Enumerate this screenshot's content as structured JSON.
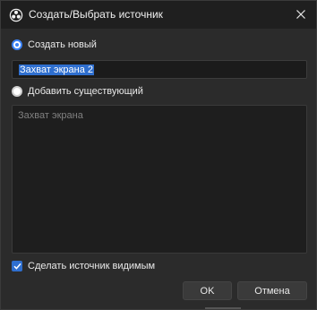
{
  "window": {
    "title": "Создать/Выбрать источник",
    "icon": "obs-logo-icon"
  },
  "options": {
    "create_new_label": "Создать новый",
    "create_new_selected": true,
    "add_existing_label": "Добавить существующий",
    "add_existing_selected": false
  },
  "name_input": {
    "value": "Захват экрана 2"
  },
  "existing_sources": {
    "items": [
      "Захват экрана"
    ]
  },
  "visible_checkbox": {
    "label": "Сделать источник видимым",
    "checked": true
  },
  "buttons": {
    "ok_label": "OK",
    "cancel_label": "Отмена"
  },
  "colors": {
    "accent": "#2f6fcf",
    "window_bg": "#2b2b2b",
    "titlebar_bg": "#1f1f1f"
  }
}
